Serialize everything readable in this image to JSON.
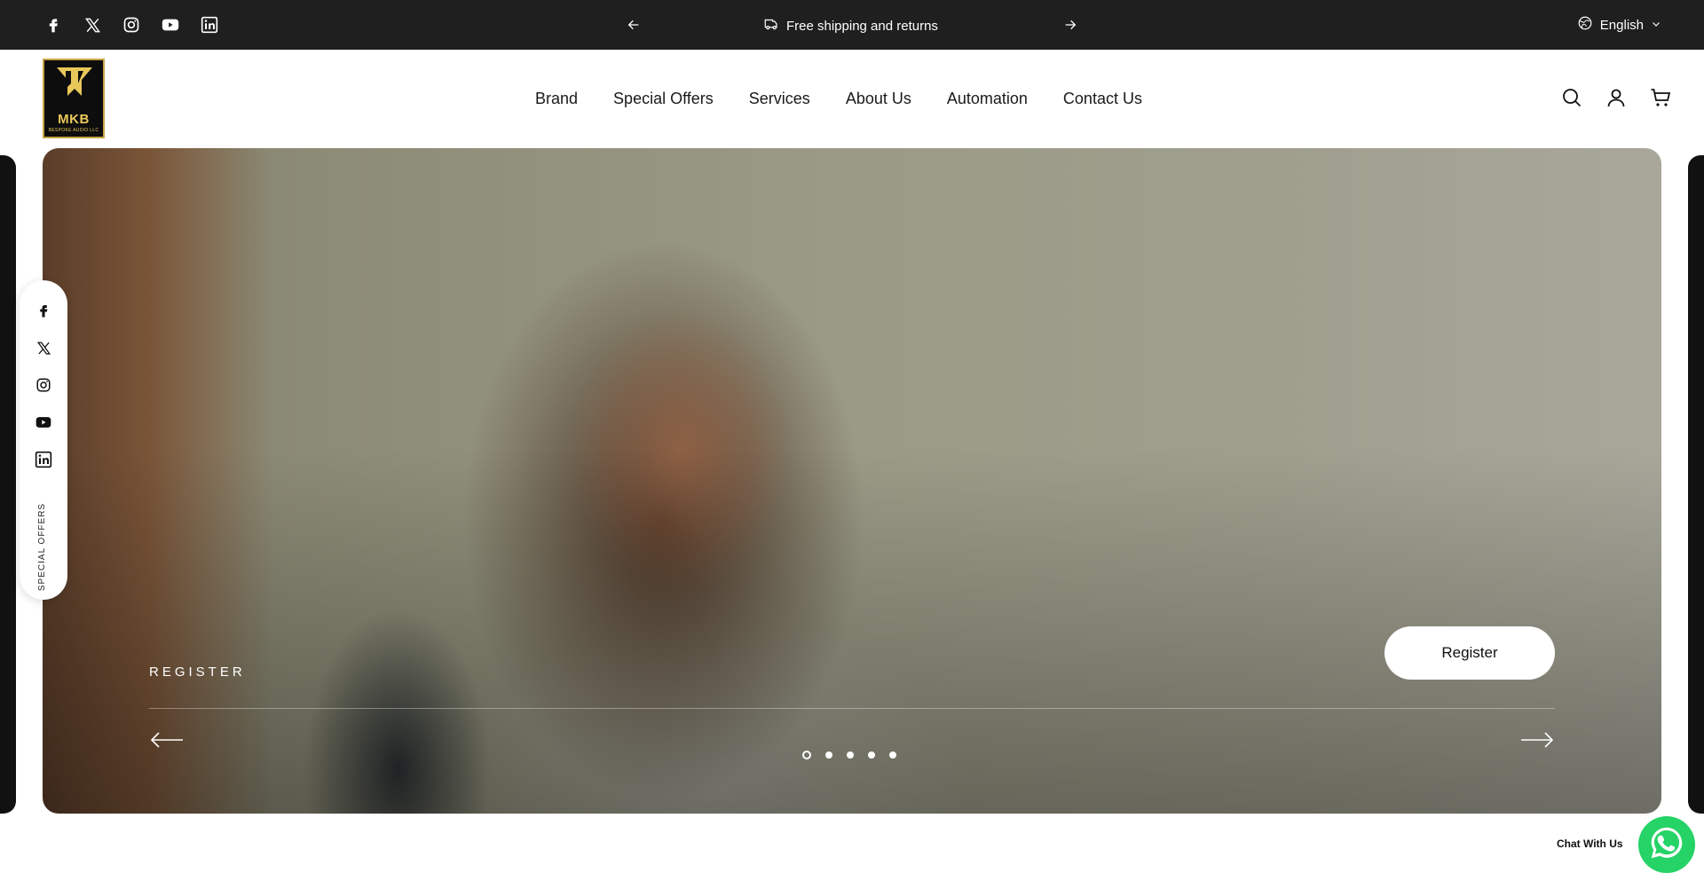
{
  "announcement": {
    "social_links": [
      {
        "icon": "facebook-icon"
      },
      {
        "icon": "x-icon"
      },
      {
        "icon": "instagram-icon"
      },
      {
        "icon": "youtube-icon"
      },
      {
        "icon": "linkedin-icon"
      }
    ],
    "message": "Free shipping and returns",
    "message_icon": "truck-icon",
    "language": "English"
  },
  "header": {
    "logo": {
      "text": "MKB",
      "subtext": "BESPOKE AUDIO LLC"
    },
    "nav": [
      "Brand",
      "Special Offers",
      "Services",
      "About Us",
      "Automation",
      "Contact Us"
    ],
    "icons": [
      "search-icon",
      "account-icon",
      "cart-icon"
    ]
  },
  "hero": {
    "kicker": "REGISTER",
    "cta_label": "Register",
    "slide_count": 5,
    "active_slide": 1
  },
  "side_rail": {
    "icons": [
      "facebook-icon",
      "x-icon",
      "instagram-icon",
      "youtube-icon",
      "linkedin-icon"
    ],
    "label": "SPECIAL OFFERS"
  },
  "chat": {
    "label": "Chat With Us",
    "icon": "whatsapp-icon"
  },
  "colors": {
    "announcement_bg": "#1f1f1f",
    "logo_gold": "#e9c85a",
    "whatsapp_green": "#25d366"
  }
}
